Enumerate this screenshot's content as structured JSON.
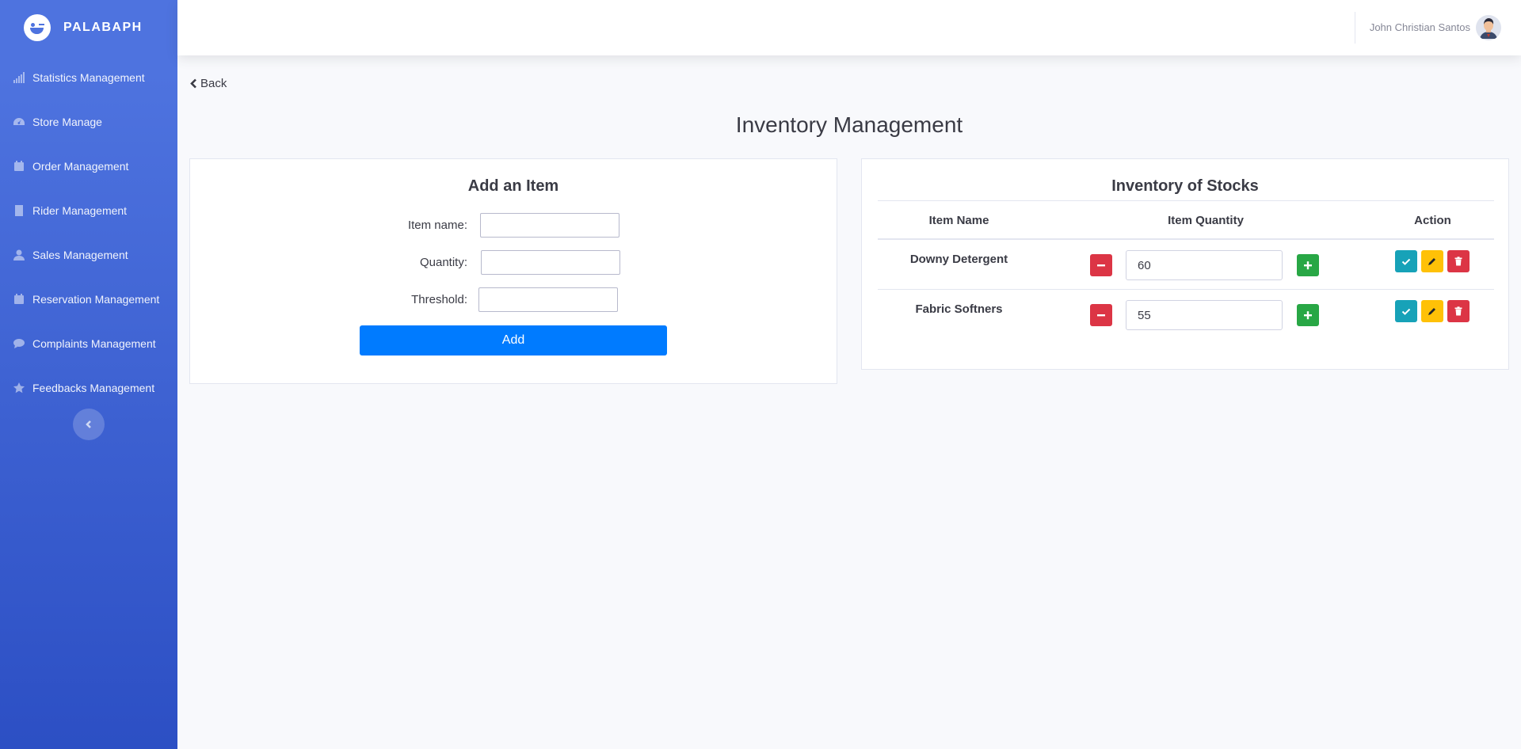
{
  "brand": {
    "name": "PALABAPH"
  },
  "sidebar": {
    "items": [
      {
        "label": "Statistics Management",
        "icon": "bar-chart-icon"
      },
      {
        "label": "Store Manage",
        "icon": "dashboard-gauge-icon"
      },
      {
        "label": "Order Management",
        "icon": "calendar-icon"
      },
      {
        "label": "Rider Management",
        "icon": "building-icon"
      },
      {
        "label": "Sales Management",
        "icon": "user-icon"
      },
      {
        "label": "Reservation Management",
        "icon": "calendar-icon"
      },
      {
        "label": "Complaints Management",
        "icon": "comment-icon"
      },
      {
        "label": "Feedbacks Management",
        "icon": "star-icon"
      }
    ],
    "toggle_icon": "chevron-left-icon"
  },
  "topbar": {
    "user_name": "John Christian Santos"
  },
  "main": {
    "back_label": "Back",
    "page_title": "Inventory Management",
    "add_form": {
      "title": "Add an Item",
      "item_name_label": "Item name:",
      "item_name_value": "",
      "quantity_label": "Quantity:",
      "quantity_value": "",
      "threshold_label": "Threshold:",
      "threshold_value": "",
      "add_button": "Add"
    },
    "inventory": {
      "title": "Inventory of Stocks",
      "columns": [
        "Item Name",
        "Item Quantity",
        "Action"
      ],
      "rows": [
        {
          "name": "Downy Detergent",
          "quantity": "60"
        },
        {
          "name": "Fabric Softners",
          "quantity": "55"
        }
      ]
    }
  },
  "colors": {
    "sidebar_top": "#4e73df",
    "sidebar_bottom": "#2c4fc4",
    "primary": "#007bff",
    "danger": "#dc3545",
    "success": "#28a745",
    "info": "#17a2b8",
    "warning": "#ffc107"
  }
}
